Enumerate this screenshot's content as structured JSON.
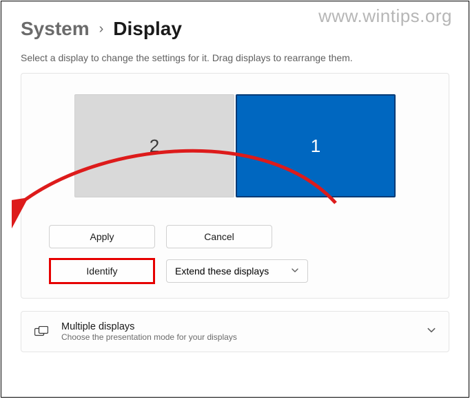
{
  "watermark": "www.wintips.org",
  "breadcrumb": {
    "parent": "System",
    "separator": "›",
    "current": "Display"
  },
  "hint": "Select a display to change the settings for it. Drag displays to rearrange them.",
  "monitors": {
    "left_label": "2",
    "right_label": "1"
  },
  "buttons": {
    "apply": "Apply",
    "cancel": "Cancel",
    "identify": "Identify"
  },
  "display_mode": {
    "selected": "Extend these displays"
  },
  "multiple_displays": {
    "title": "Multiple displays",
    "subtitle": "Choose the presentation mode for your displays"
  }
}
